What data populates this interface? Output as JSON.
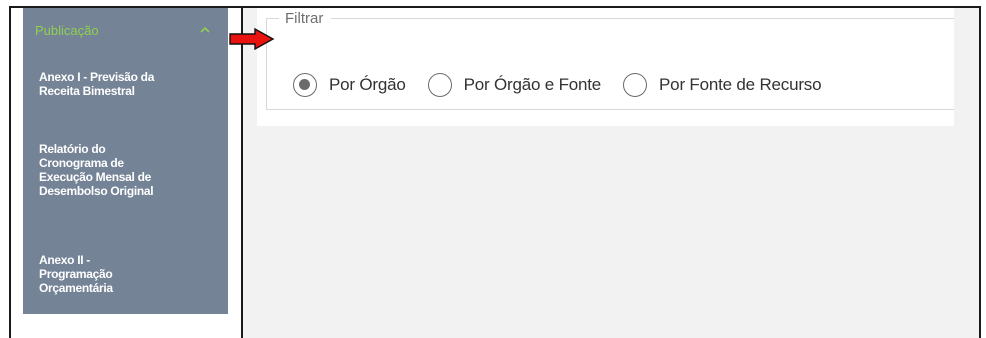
{
  "sidebar": {
    "header_label": "Publicação",
    "header_icon": "chevron-up-icon",
    "items": [
      {
        "label_lines": [
          "Anexo I - Previsão da",
          "Receita Bimestral"
        ]
      },
      {
        "label_lines": [
          "Relatório do",
          "Cronograma de",
          "Execução Mensal de",
          "Desembolso Original"
        ]
      },
      {
        "label_lines": [
          "Anexo II -",
          "Programação",
          "Orçamentária"
        ]
      }
    ]
  },
  "annotation": {
    "icon": "red-arrow-icon",
    "color": "#e8130f"
  },
  "filter": {
    "legend": "Filtrar",
    "options": [
      {
        "label": "Por Órgão",
        "checked": true
      },
      {
        "label": "Por Órgão e Fonte",
        "checked": false
      },
      {
        "label": "Por Fonte de Recurso",
        "checked": false
      }
    ]
  },
  "colors": {
    "sidebar_bg": "#748396",
    "sidebar_header_text": "#8fd14f",
    "content_bg": "#f2f2f2",
    "border": "#1a1a1a"
  }
}
